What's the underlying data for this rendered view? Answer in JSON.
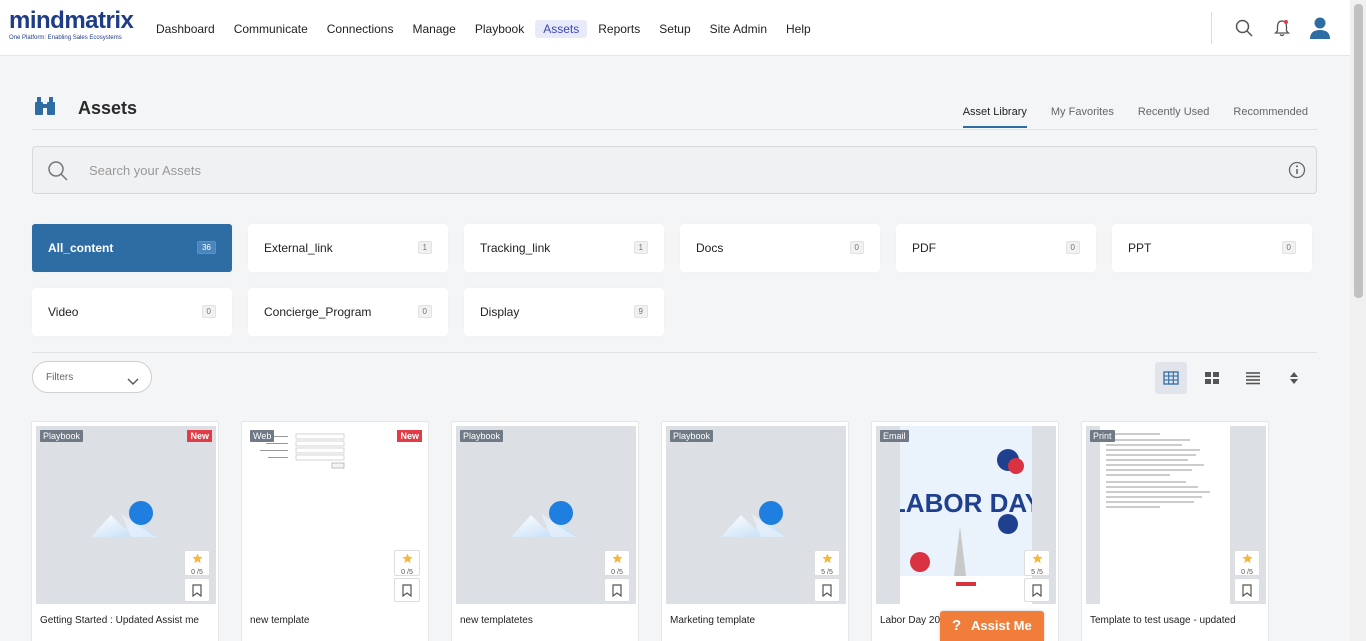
{
  "brand": {
    "name": "mindmatrix",
    "tagline": "One Platform: Enabling Sales Ecosystems"
  },
  "nav": [
    "Dashboard",
    "Communicate",
    "Connections",
    "Manage",
    "Playbook",
    "Assets",
    "Reports",
    "Setup",
    "Site Admin",
    "Help"
  ],
  "nav_active": "Assets",
  "page": {
    "title": "Assets",
    "tabs": [
      "Asset Library",
      "My Favorites",
      "Recently Used",
      "Recommended"
    ]
  },
  "search": {
    "placeholder": "Search your Assets"
  },
  "categories": [
    {
      "label": "All_content",
      "count": "36"
    },
    {
      "label": "External_link",
      "count": "1"
    },
    {
      "label": "Tracking_link",
      "count": "1"
    },
    {
      "label": "Docs",
      "count": "0"
    },
    {
      "label": "PDF",
      "count": "0"
    },
    {
      "label": "PPT",
      "count": "0"
    },
    {
      "label": "Video",
      "count": "0"
    },
    {
      "label": "Concierge_Program",
      "count": "0"
    },
    {
      "label": "Display",
      "count": "9"
    }
  ],
  "filter": {
    "label": "Filters"
  },
  "cards": [
    {
      "type": "Playbook",
      "new": "New",
      "rating": "0 /5",
      "name": "Getting Started : Updated Assist me"
    },
    {
      "type": "Web",
      "new": "New",
      "rating": "0 /5",
      "name": "new template"
    },
    {
      "type": "Playbook",
      "rating": "0 /5",
      "name": "new templatetes"
    },
    {
      "type": "Playbook",
      "rating": "5 /5",
      "name": "Marketing template"
    },
    {
      "type": "Email",
      "rating": "5 /5",
      "name": "Labor Day 2023",
      "thumb_text": "LABOR DAY"
    },
    {
      "type": "Print",
      "rating": "0 /5",
      "name": "Template to test usage - updated"
    }
  ],
  "assist": {
    "q": "?",
    "label": "Assist Me"
  },
  "colors": {
    "primary": "#2e6da4",
    "accent": "#f07d3a",
    "new_badge": "#e03d48",
    "star": "#f6b73c"
  }
}
